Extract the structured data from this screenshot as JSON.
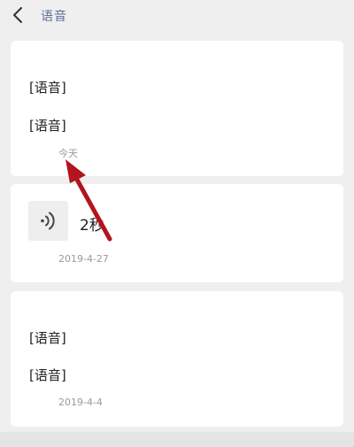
{
  "header": {
    "title": "语音"
  },
  "cards": [
    {
      "messages": [
        "[语音]",
        "[语音]"
      ],
      "date": "今天"
    },
    {
      "duration": "2秒",
      "date": "2019-4-27"
    },
    {
      "messages": [
        "[语音]",
        "[语音]"
      ],
      "date": "2019-4-4"
    }
  ],
  "colors": {
    "title": "#5a6e96",
    "annotation_arrow": "#b3141e"
  },
  "icons": {
    "back": "chevron-left-icon",
    "voice": "voice-wave-icon"
  }
}
